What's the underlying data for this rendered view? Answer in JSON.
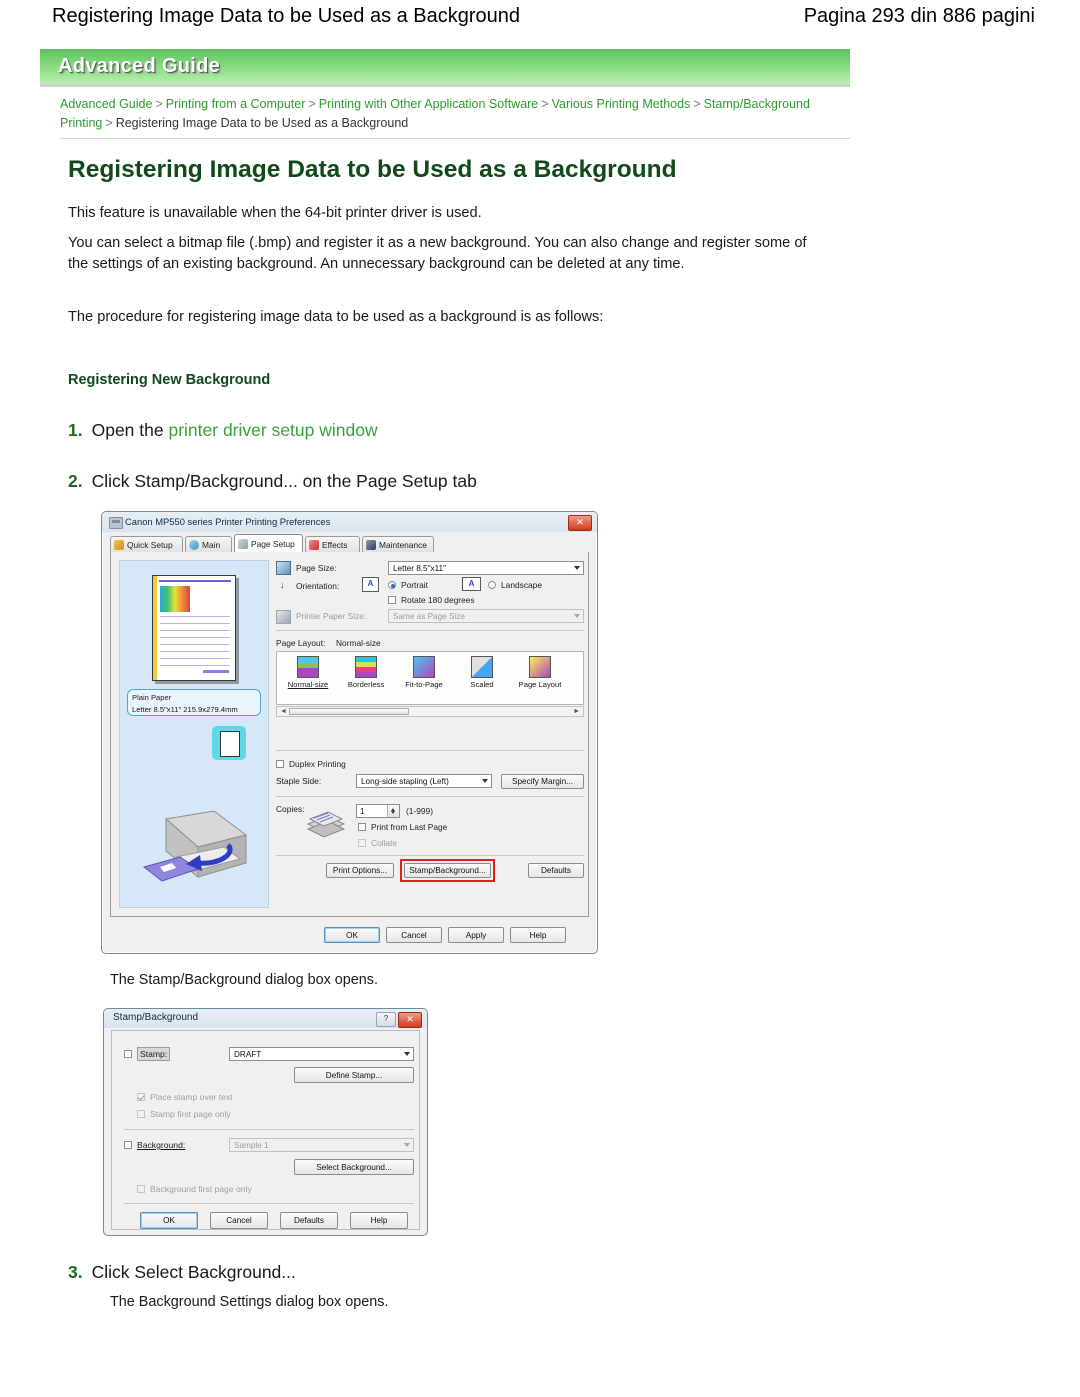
{
  "page_header": {
    "title": "Registering Image Data to be Used as a Background",
    "page_info": "Pagina 293 din 886 pagini"
  },
  "banner": {
    "label": "Advanced Guide"
  },
  "breadcrumb": {
    "items": [
      "Advanced Guide",
      "Printing from a Computer",
      "Printing with Other Application Software",
      "Various Printing Methods",
      "Stamp/Background Printing"
    ],
    "current": "Registering Image Data to be Used as a Background",
    "separator": ">"
  },
  "article": {
    "heading": "Registering Image Data to be Used as a Background",
    "paragraph_1": "This feature is unavailable when the 64-bit printer driver is used.",
    "paragraph_2": "You can select a bitmap file (.bmp) and register it as a new background. You can also change and register some of the settings of an existing background. An unnecessary background can be deleted at any time.",
    "paragraph_3": "The procedure for registering image data to be used as a background is as follows:",
    "subheading": "Registering New Background",
    "steps": [
      {
        "number": "1.",
        "text_before": "Open the ",
        "link": "printer driver setup window",
        "text_after": ""
      },
      {
        "number": "2.",
        "text_before": "Click Stamp/Background... on the Page Setup tab",
        "link": "",
        "text_after": ""
      },
      {
        "number": "3.",
        "text_before": "Click Select Background...",
        "link": "",
        "text_after": ""
      }
    ],
    "note_1": "The Stamp/Background dialog box opens.",
    "note_2": "The Background Settings dialog box opens."
  },
  "prefs_dialog": {
    "title": "Canon MP550 series Printer Printing Preferences",
    "close_label": "✕",
    "tabs": [
      {
        "label": "Quick Setup",
        "active": false
      },
      {
        "label": "Main",
        "active": false
      },
      {
        "label": "Page Setup",
        "active": true
      },
      {
        "label": "Effects",
        "active": false
      },
      {
        "label": "Maintenance",
        "active": false
      }
    ],
    "preview": {
      "media_line_1": "Plain Paper",
      "media_line_2": "Letter 8.5\"x11\" 215.9x279.4mm"
    },
    "page_size_label": "Page Size:",
    "page_size_value": "Letter 8.5\"x11\"",
    "orientation_label": "Orientation:",
    "portrait_label": "Portrait",
    "landscape_label": "Landscape",
    "rotate_label": "Rotate 180 degrees",
    "printer_paper_size_label": "Printer Paper Size:",
    "printer_paper_size_value": "Same as Page Size",
    "page_layout_label": "Page Layout:",
    "page_layout_value": "Normal-size",
    "layout_items": [
      {
        "label": "Normal-size"
      },
      {
        "label": "Borderless"
      },
      {
        "label": "Fit-to-Page"
      },
      {
        "label": "Scaled"
      },
      {
        "label": "Page Layout"
      }
    ],
    "duplex_label": "Duplex Printing",
    "staple_side_label": "Staple Side:",
    "staple_side_value": "Long-side stapling (Left)",
    "specify_margin_label": "Specify Margin...",
    "copies_label": "Copies:",
    "copies_value": "1",
    "copies_range": "(1-999)",
    "print_last_page_label": "Print from Last Page",
    "collate_label": "Collate",
    "print_options_label": "Print Options...",
    "stamp_background_label": "Stamp/Background...",
    "defaults_label": "Defaults",
    "ok_label": "OK",
    "cancel_label": "Cancel",
    "apply_label": "Apply",
    "help_label": "Help"
  },
  "stamp_dialog": {
    "title": "Stamp/Background",
    "help_label": "?",
    "close_label": "✕",
    "stamp_label": "Stamp:",
    "stamp_value": "DRAFT",
    "define_stamp_label": "Define Stamp...",
    "place_stamp_over_text_label": "Place stamp over text",
    "stamp_first_page_only_label": "Stamp first page only",
    "background_label": "Background:",
    "background_value": "Sample 1",
    "select_background_label": "Select Background...",
    "background_first_page_only_label": "Background first page only",
    "ok_label": "OK",
    "cancel_label": "Cancel",
    "defaults_label": "Defaults",
    "help_label_btn": "Help"
  },
  "colors": {
    "heading_green": "#11491a",
    "link_green": "#3aa03a",
    "banner_green": "#6fcf6b",
    "highlight_red": "#e02020"
  }
}
